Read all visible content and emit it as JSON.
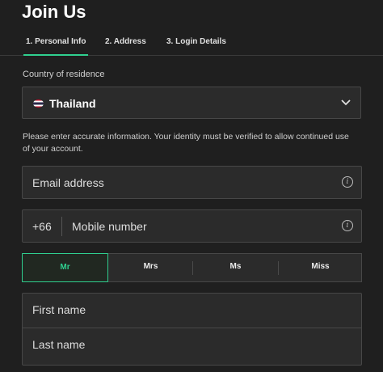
{
  "page": {
    "title": "Join Us"
  },
  "steps": [
    {
      "label": "1. Personal Info",
      "active": true
    },
    {
      "label": "2. Address",
      "active": false
    },
    {
      "label": "3. Login Details",
      "active": false
    }
  ],
  "country": {
    "label": "Country of residence",
    "value": "Thailand",
    "flag_icon": "thailand-flag-icon"
  },
  "notice": "Please enter accurate information. Your identity must be verified to allow continued use of your account.",
  "email": {
    "placeholder": "Email address"
  },
  "mobile": {
    "prefix": "+66",
    "placeholder": "Mobile number"
  },
  "salutation": {
    "options": [
      "Mr",
      "Mrs",
      "Ms",
      "Miss"
    ],
    "selected": "Mr"
  },
  "first_name": {
    "placeholder": "First name"
  },
  "last_name": {
    "placeholder": "Last name"
  },
  "colors": {
    "background": "#1f1f1f",
    "field": "#2b2b2b",
    "accent": "#2fcf8f"
  }
}
